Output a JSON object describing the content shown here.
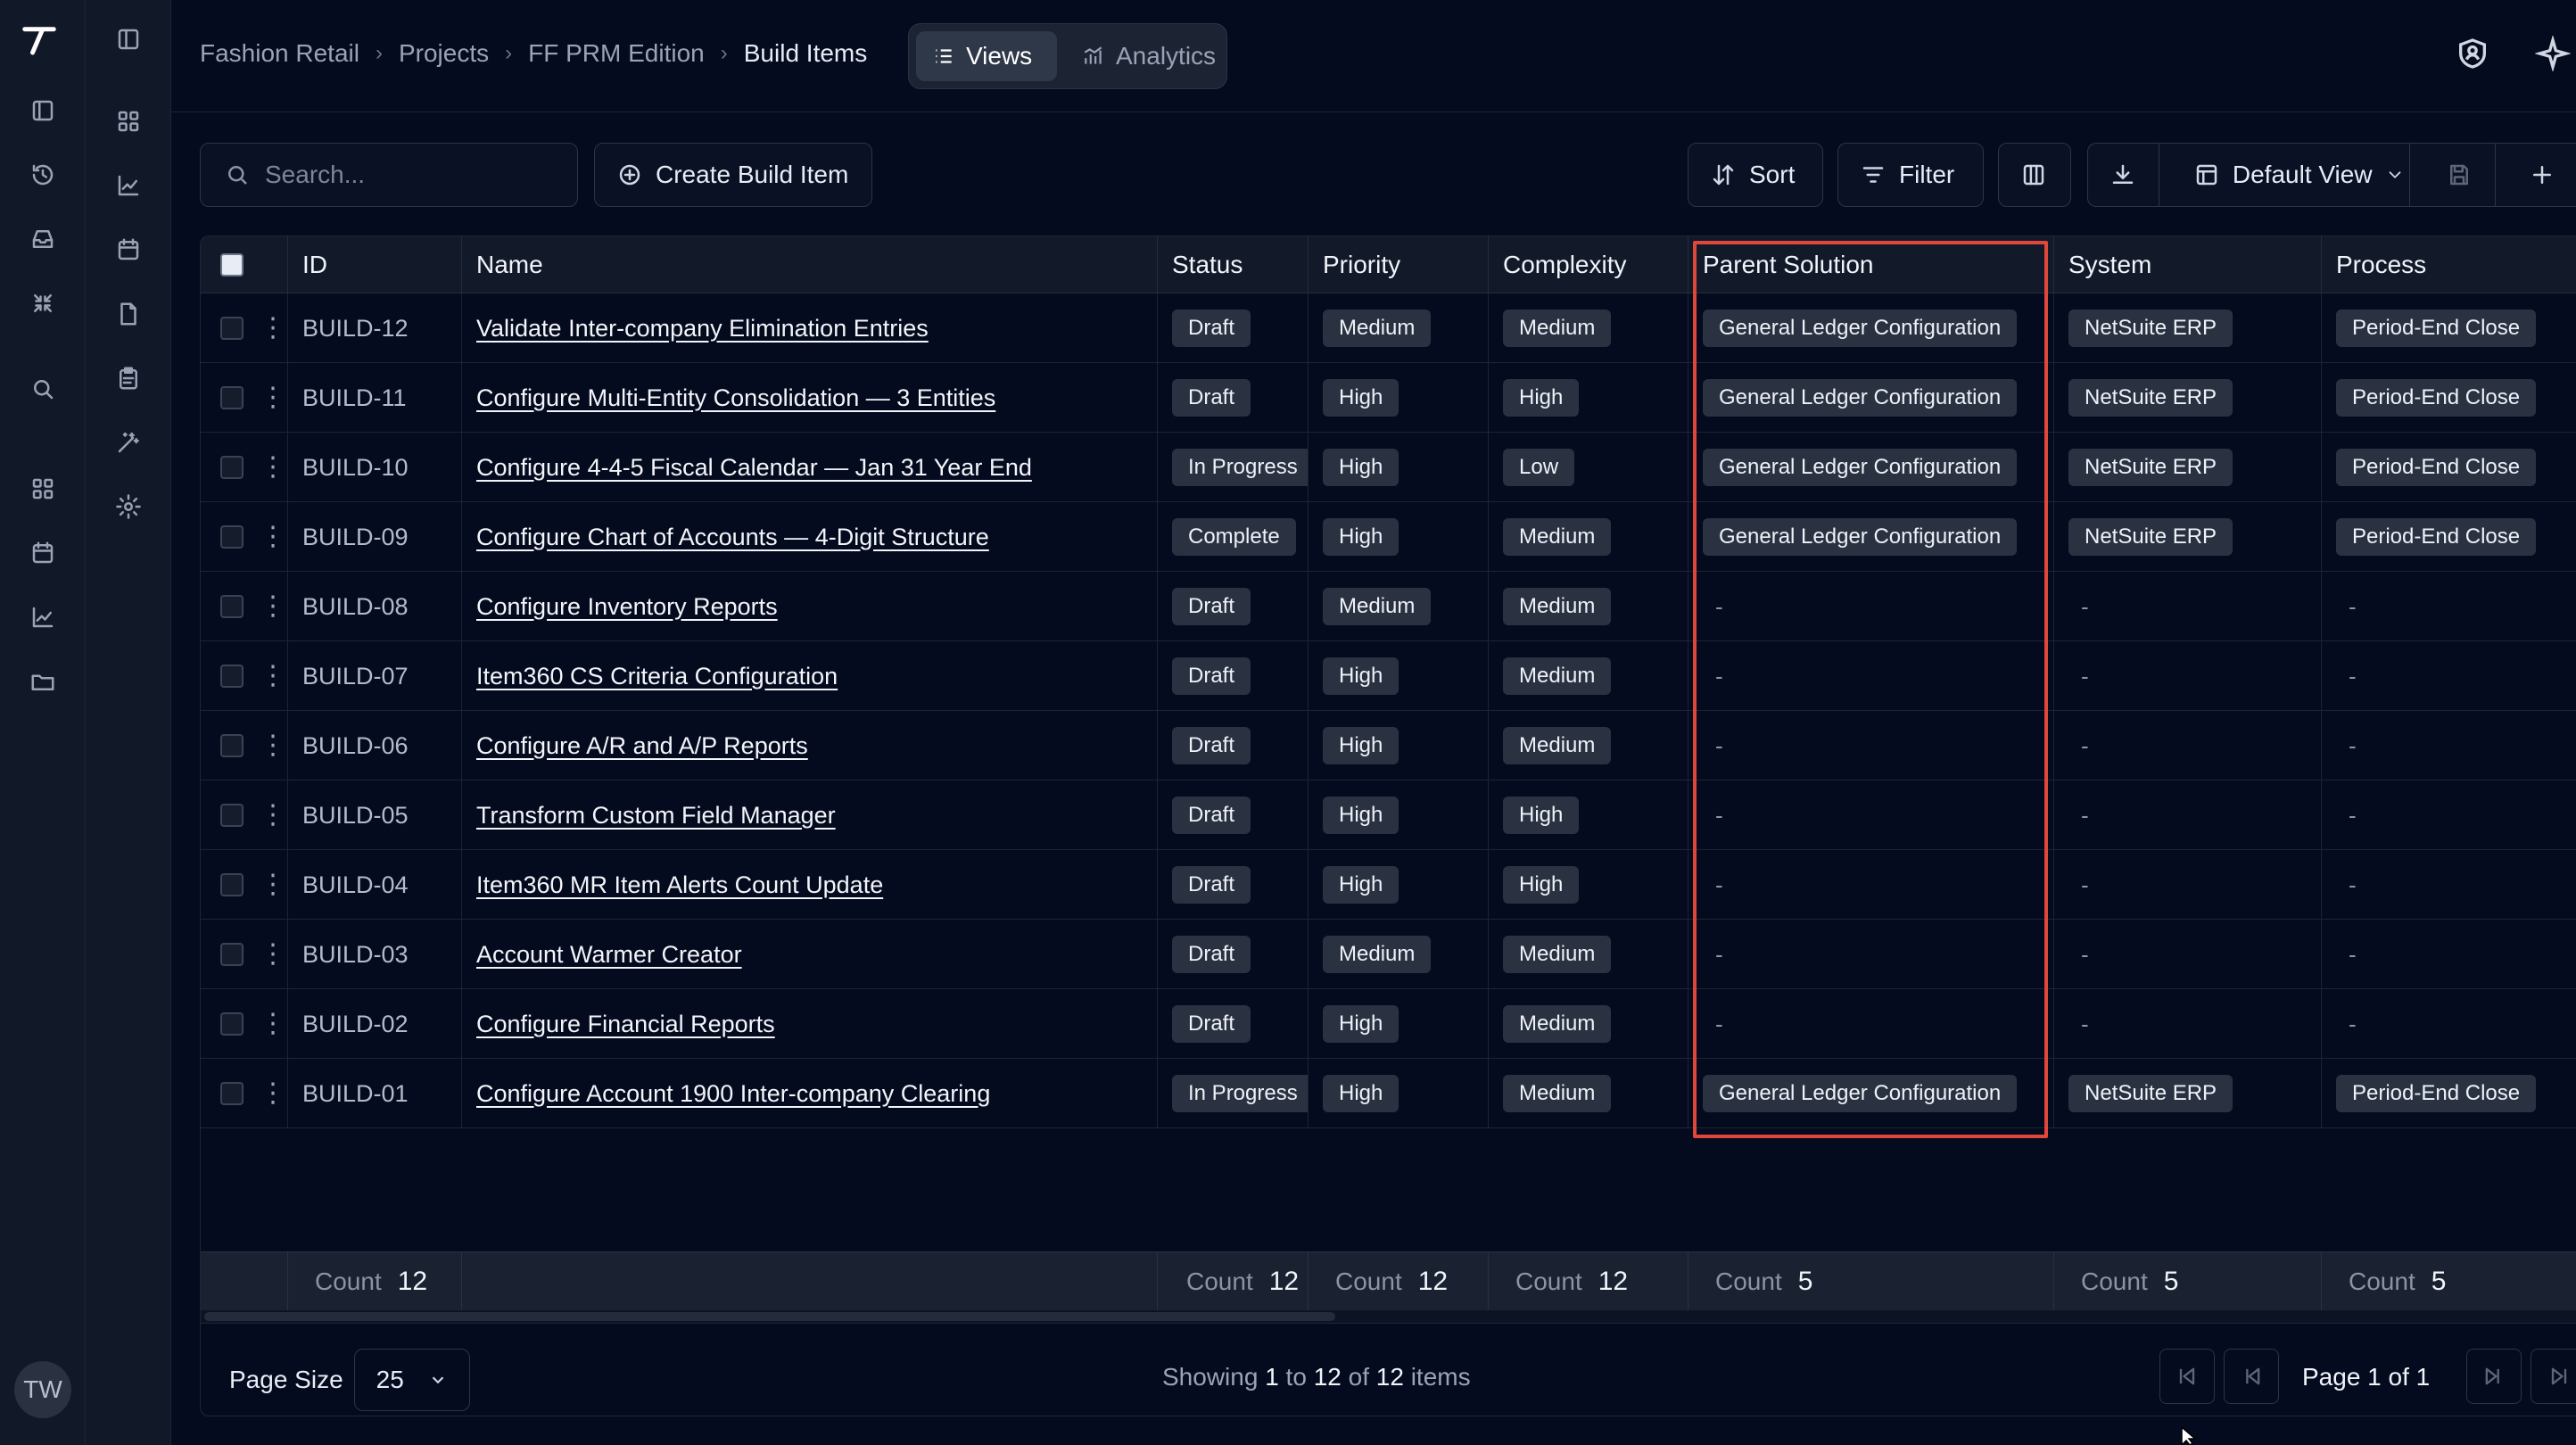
{
  "breadcrumb": [
    "Fashion Retail",
    "Projects",
    "FF PRM Edition",
    "Build Items"
  ],
  "view_toggle": {
    "views": "Views",
    "analytics": "Analytics"
  },
  "user": {
    "initials": "TW"
  },
  "toolbar": {
    "search_placeholder": "Search...",
    "create": "Create Build Item",
    "sort": "Sort",
    "filter": "Filter",
    "default_view": "Default View"
  },
  "columns": [
    "ID",
    "Name",
    "Status",
    "Priority",
    "Complexity",
    "Parent Solution",
    "System",
    "Process"
  ],
  "rows": [
    {
      "id": "BUILD-12",
      "name": "Validate Inter-company Elimination Entries",
      "status": "Draft",
      "priority": "Medium",
      "complexity": "Medium",
      "parent": "General Ledger Configuration",
      "system": "NetSuite ERP",
      "process": "Period-End Close"
    },
    {
      "id": "BUILD-11",
      "name": "Configure Multi-Entity Consolidation — 3 Entities",
      "status": "Draft",
      "priority": "High",
      "complexity": "High",
      "parent": "General Ledger Configuration",
      "system": "NetSuite ERP",
      "process": "Period-End Close"
    },
    {
      "id": "BUILD-10",
      "name": "Configure 4-4-5 Fiscal Calendar — Jan 31 Year End",
      "status": "In Progress",
      "priority": "High",
      "complexity": "Low",
      "parent": "General Ledger Configuration",
      "system": "NetSuite ERP",
      "process": "Period-End Close"
    },
    {
      "id": "BUILD-09",
      "name": "Configure Chart of Accounts — 4-Digit Structure",
      "status": "Complete",
      "priority": "High",
      "complexity": "Medium",
      "parent": "General Ledger Configuration",
      "system": "NetSuite ERP",
      "process": "Period-End Close"
    },
    {
      "id": "BUILD-08",
      "name": "Configure Inventory Reports",
      "status": "Draft",
      "priority": "Medium",
      "complexity": "Medium",
      "parent": "-",
      "system": "-",
      "process": "-"
    },
    {
      "id": "BUILD-07",
      "name": "Item360 CS Criteria Configuration",
      "status": "Draft",
      "priority": "High",
      "complexity": "Medium",
      "parent": "-",
      "system": "-",
      "process": "-"
    },
    {
      "id": "BUILD-06",
      "name": "Configure A/R and A/P Reports",
      "status": "Draft",
      "priority": "High",
      "complexity": "Medium",
      "parent": "-",
      "system": "-",
      "process": "-"
    },
    {
      "id": "BUILD-05",
      "name": "Transform Custom Field Manager",
      "status": "Draft",
      "priority": "High",
      "complexity": "High",
      "parent": "-",
      "system": "-",
      "process": "-"
    },
    {
      "id": "BUILD-04",
      "name": "Item360 MR Item Alerts Count Update",
      "status": "Draft",
      "priority": "High",
      "complexity": "High",
      "parent": "-",
      "system": "-",
      "process": "-"
    },
    {
      "id": "BUILD-03",
      "name": "Account Warmer Creator",
      "status": "Draft",
      "priority": "Medium",
      "complexity": "Medium",
      "parent": "-",
      "system": "-",
      "process": "-"
    },
    {
      "id": "BUILD-02",
      "name": "Configure Financial Reports",
      "status": "Draft",
      "priority": "High",
      "complexity": "Medium",
      "parent": "-",
      "system": "-",
      "process": "-"
    },
    {
      "id": "BUILD-01",
      "name": "Configure Account 1900 Inter-company Clearing",
      "status": "In Progress",
      "priority": "High",
      "complexity": "Medium",
      "parent": "General Ledger Configuration",
      "system": "NetSuite ERP",
      "process": "Period-End Close"
    }
  ],
  "footer_counts": {
    "label": "Count",
    "id": "12",
    "status": "12",
    "priority": "12",
    "complexity": "12",
    "parent": "5",
    "system": "5",
    "process": "5"
  },
  "pagination": {
    "page_size_label": "Page Size",
    "page_size": "25",
    "showing_prefix": "Showing",
    "from": "1",
    "to_word": "to",
    "to": "12",
    "of_word": "of",
    "total": "12",
    "items_word": "items",
    "page_label": "Page 1 of 1"
  },
  "colors": {
    "background": "#050b1e",
    "sidebar": "#111827",
    "chip": "#2a3242",
    "highlight": "#e0463a"
  }
}
